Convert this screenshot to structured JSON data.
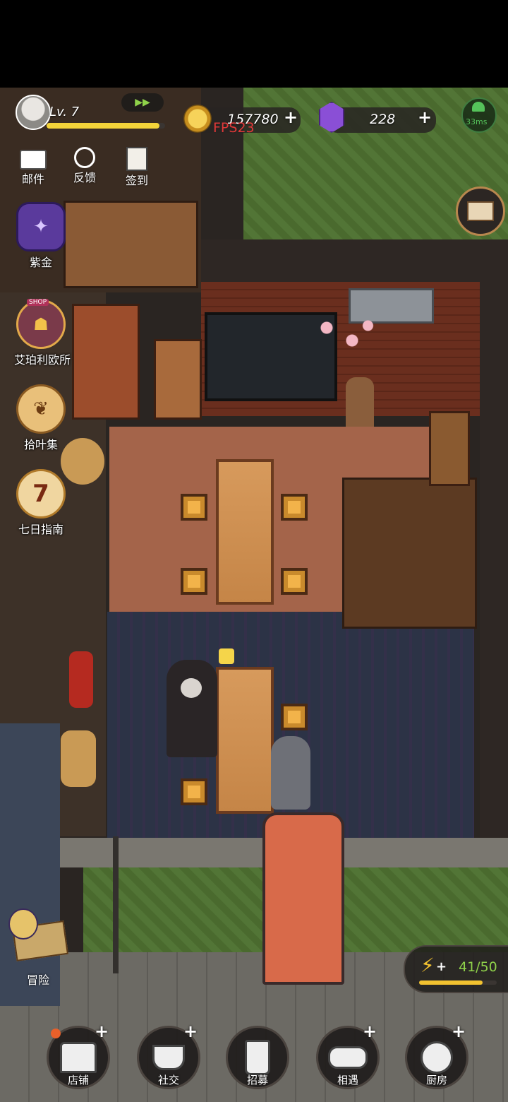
{
  "player": {
    "level": "Lv. 7",
    "xp_fraction": 0.95
  },
  "currency": {
    "gold": "157780",
    "gems": "228"
  },
  "debug": {
    "fps": "FPS23"
  },
  "network": {
    "ping": "33ms"
  },
  "side_menu": {
    "mail": "邮件",
    "feedback": "反馈",
    "checkin": "签到",
    "purple_gold": "紫金",
    "shop_label": "艾珀利欧所",
    "shop_badge": "SHOP",
    "leaf": "拾叶集",
    "seven_day": "七日指南",
    "seven_day_number": "7",
    "adventure": "冒险"
  },
  "energy": {
    "value": "41/50",
    "fraction": 0.82
  },
  "bottom_nav": [
    "店铺",
    "社交",
    "招募",
    "相遇",
    "厨房"
  ],
  "colors": {
    "xp_bar": "#f4d43a",
    "energy_bar": "#f2c230",
    "gem": "#8a4fd6",
    "gold": "#f2c230",
    "ping": "#55c25a"
  }
}
